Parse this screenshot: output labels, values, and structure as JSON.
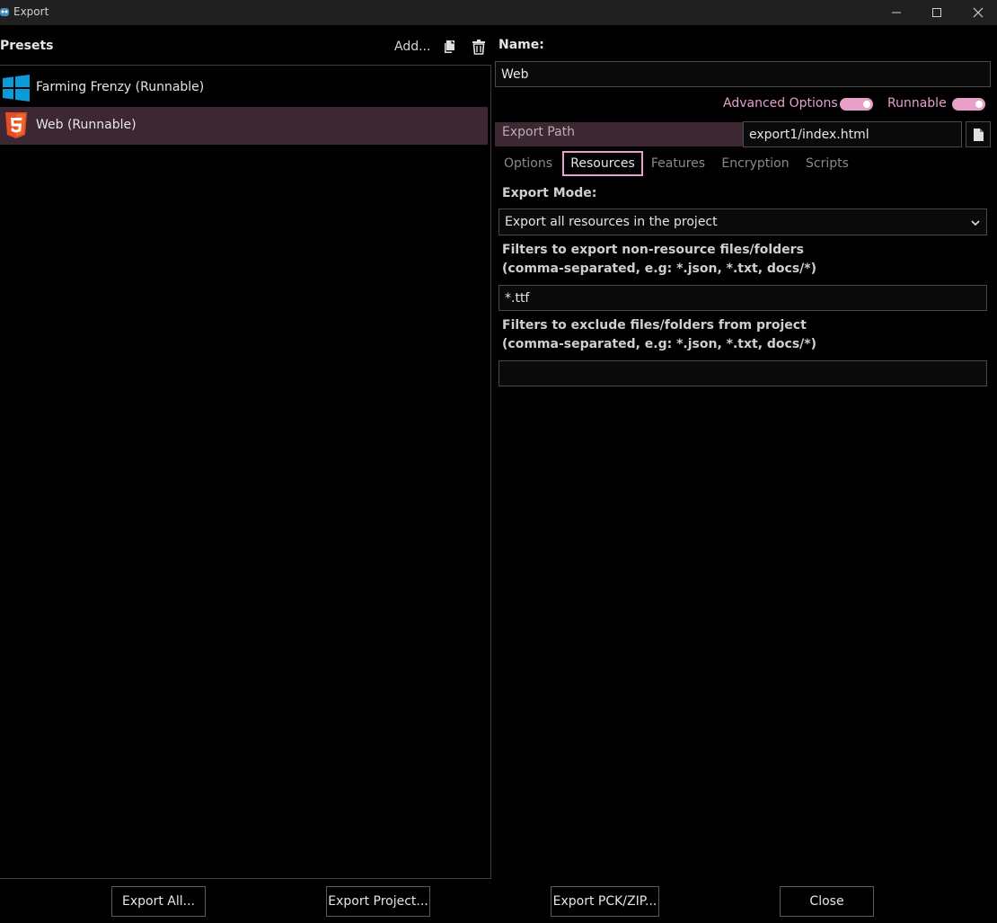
{
  "window": {
    "title": "Export"
  },
  "presets": {
    "heading": "Presets",
    "add_label": "Add...",
    "items": [
      {
        "label": "Farming Frenzy (Runnable)",
        "icon": "windows-icon",
        "selected": false
      },
      {
        "label": "Web (Runnable)",
        "icon": "html5-icon",
        "selected": true
      }
    ]
  },
  "settings": {
    "name_label": "Name:",
    "name_value": "Web",
    "advanced_options_label": "Advanced Options",
    "advanced_options_on": true,
    "runnable_label": "Runnable",
    "runnable_on": true,
    "export_path_label": "Export Path",
    "export_path_value": "export1/index.html"
  },
  "tabs": [
    {
      "label": "Options",
      "active": false
    },
    {
      "label": "Resources",
      "active": true
    },
    {
      "label": "Features",
      "active": false
    },
    {
      "label": "Encryption",
      "active": false
    },
    {
      "label": "Scripts",
      "active": false
    }
  ],
  "resources": {
    "export_mode_label": "Export Mode:",
    "export_mode_value": "Export all resources in the project",
    "include_filter_label_line1": "Filters to export non-resource files/folders",
    "include_filter_label_line2": "(comma-separated, e.g: *.json, *.txt, docs/*)",
    "include_filter_value": "*.ttf",
    "exclude_filter_label_line1": "Filters to exclude files/folders from project",
    "exclude_filter_label_line2": "(comma-separated, e.g: *.json, *.txt, docs/*)",
    "exclude_filter_value": ""
  },
  "footer": {
    "export_all_label": "Export All...",
    "export_project_label": "Export Project...",
    "export_pck_label": "Export PCK/ZIP...",
    "close_label": "Close"
  },
  "colors": {
    "accent": "#e8a0c8",
    "selection": "#3c2733",
    "background": "#000000",
    "windows_blue": "#0a9bd8",
    "html5_orange": "#e44d26"
  }
}
